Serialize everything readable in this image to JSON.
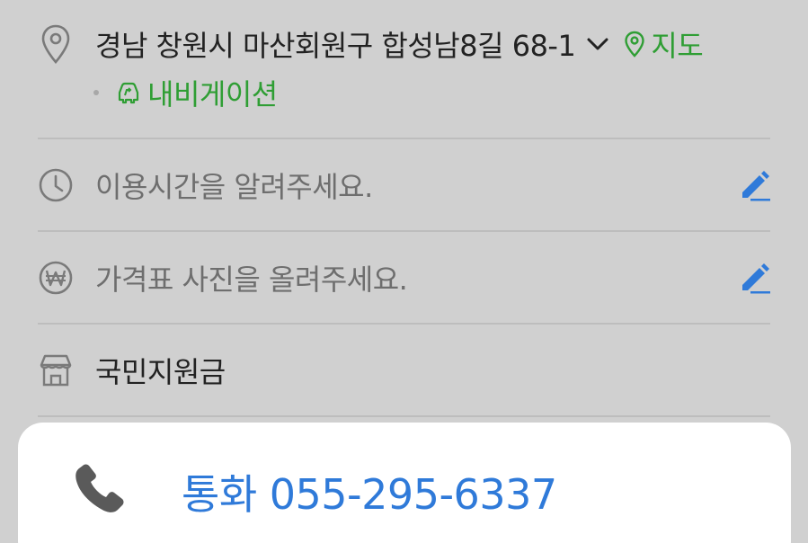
{
  "address": {
    "text": "경남 창원시 마산회원구 합성남8길 68-1",
    "map_label": "지도",
    "nav_label": "내비게이션"
  },
  "hours": {
    "placeholder": "이용시간을 알려주세요."
  },
  "price": {
    "placeholder": "가격표 사진을 올려주세요."
  },
  "subsidy": {
    "label": "국민지원금"
  },
  "call": {
    "label": "통화 055-295-6337"
  },
  "colors": {
    "accent_green": "#2f9e34",
    "accent_blue": "#2f7ad9",
    "background": "#d0d0d0"
  },
  "icons": {
    "address": "location-pin-icon",
    "hours": "clock-icon",
    "price": "won-icon",
    "subsidy": "store-icon",
    "call": "phone-icon",
    "edit": "pencil-icon"
  }
}
